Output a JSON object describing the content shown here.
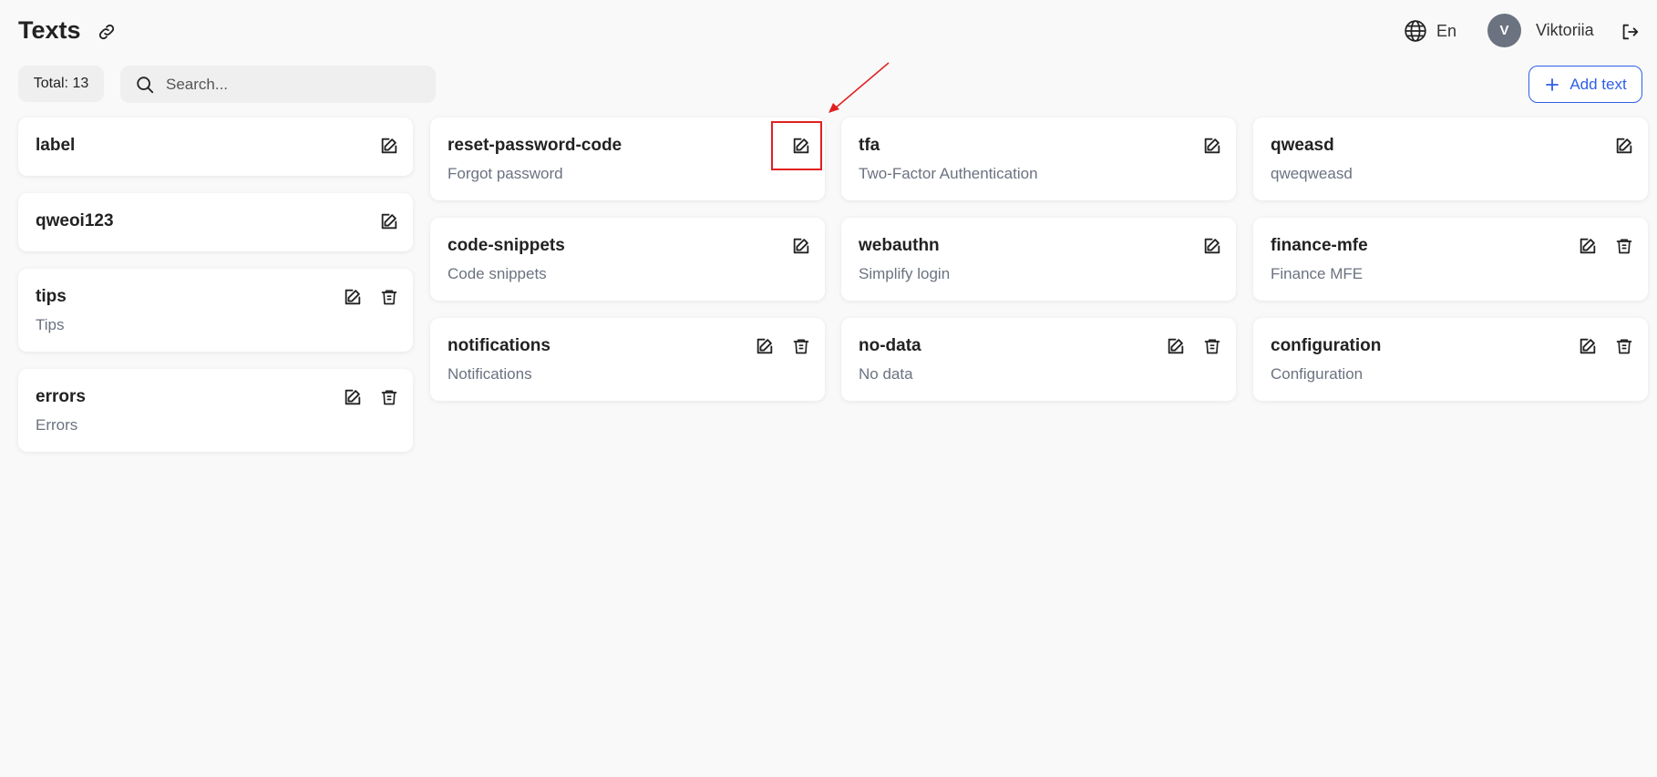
{
  "header": {
    "title": "Texts",
    "language": "En",
    "user_initial": "V",
    "user_name": "Viktoriia"
  },
  "toolbar": {
    "total_label": "Total: 13",
    "search_placeholder": "Search...",
    "search_value": "",
    "add_label": "Add text"
  },
  "colors": {
    "accent": "#2f5ee8",
    "avatar_bg": "#6b7280",
    "annotation": "#e02020"
  },
  "cards": [
    {
      "title": "label",
      "subtitle": "",
      "editable": true,
      "deletable": false
    },
    {
      "title": "qweoi123",
      "subtitle": "",
      "editable": true,
      "deletable": false
    },
    {
      "title": "tips",
      "subtitle": "Tips",
      "editable": true,
      "deletable": true
    },
    {
      "title": "errors",
      "subtitle": "Errors",
      "editable": true,
      "deletable": true
    },
    {
      "title": "reset-password-code",
      "subtitle": "Forgot password",
      "editable": true,
      "deletable": false,
      "highlighted": true
    },
    {
      "title": "code-snippets",
      "subtitle": "Code snippets",
      "editable": true,
      "deletable": false
    },
    {
      "title": "notifications",
      "subtitle": "Notifications",
      "editable": true,
      "deletable": true
    },
    {
      "title": "tfa",
      "subtitle": "Two-Factor Authentication",
      "editable": true,
      "deletable": false
    },
    {
      "title": "webauthn",
      "subtitle": "Simplify login",
      "editable": true,
      "deletable": false
    },
    {
      "title": "no-data",
      "subtitle": "No data",
      "editable": true,
      "deletable": true
    },
    {
      "title": "qweasd",
      "subtitle": "qweqweasd",
      "editable": true,
      "deletable": false
    },
    {
      "title": "finance-mfe",
      "subtitle": "Finance MFE",
      "editable": true,
      "deletable": true
    },
    {
      "title": "configuration",
      "subtitle": "Configuration",
      "editable": true,
      "deletable": true
    }
  ],
  "icons": {
    "link": "link-icon",
    "globe": "globe-icon",
    "logout": "logout-icon",
    "search": "search-icon",
    "plus": "plus-icon",
    "edit": "edit-icon",
    "delete": "trash-icon"
  }
}
